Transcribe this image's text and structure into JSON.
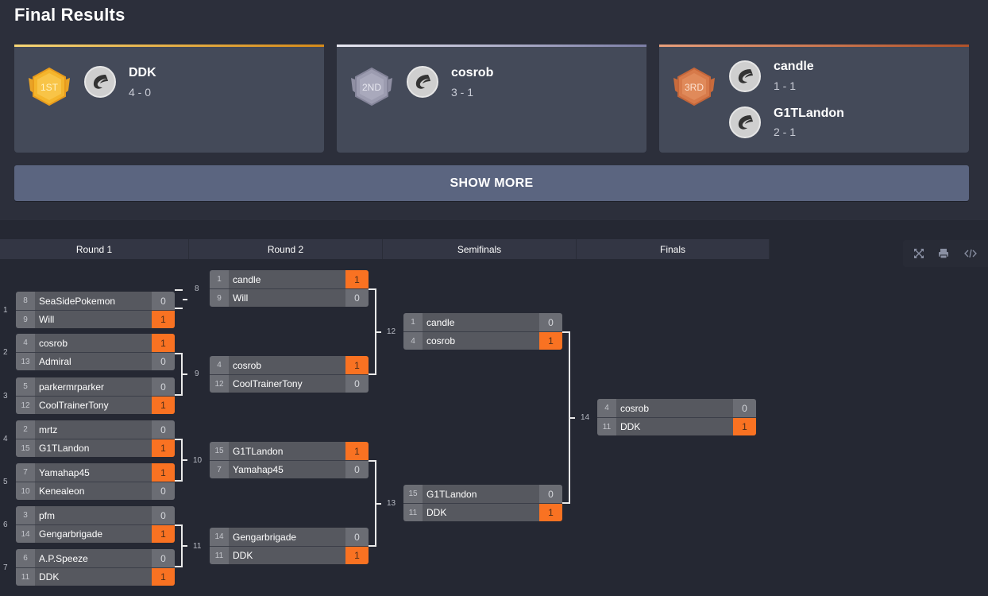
{
  "page_title": "Final Results",
  "colors": {
    "accent_win": "#f97222",
    "gold": "#f2b531",
    "silver": "#9c9cb0",
    "bronze": "#d77a4a"
  },
  "results": [
    {
      "place_label": "1ST",
      "medal_icon": "gold-medal-icon",
      "players": [
        {
          "name": "DDK",
          "record": "4 - 0"
        }
      ]
    },
    {
      "place_label": "2ND",
      "medal_icon": "silver-medal-icon",
      "players": [
        {
          "name": "cosrob",
          "record": "3 - 1"
        }
      ]
    },
    {
      "place_label": "3RD",
      "medal_icon": "bronze-medal-icon",
      "players": [
        {
          "name": "candle",
          "record": "1 - 1"
        },
        {
          "name": "G1TLandon",
          "record": "2 - 1"
        }
      ]
    }
  ],
  "show_more_label": "SHOW MORE",
  "rounds": [
    "Round 1",
    "Round 2",
    "Semifinals",
    "Finals"
  ],
  "toolbar": {
    "icons": [
      "fullscreen-icon",
      "print-icon",
      "embed-code-icon"
    ]
  },
  "matches": [
    {
      "id": "1",
      "teams": [
        {
          "seed": "8",
          "name": "SeaSidePokemon",
          "score": "0",
          "win": false
        },
        {
          "seed": "9",
          "name": "Will",
          "score": "1",
          "win": true
        }
      ]
    },
    {
      "id": "2",
      "teams": [
        {
          "seed": "4",
          "name": "cosrob",
          "score": "1",
          "win": true
        },
        {
          "seed": "13",
          "name": "Admiral",
          "score": "0",
          "win": false
        }
      ]
    },
    {
      "id": "3",
      "teams": [
        {
          "seed": "5",
          "name": "parkermrparker",
          "score": "0",
          "win": false
        },
        {
          "seed": "12",
          "name": "CoolTrainerTony",
          "score": "1",
          "win": true
        }
      ]
    },
    {
      "id": "4",
      "teams": [
        {
          "seed": "2",
          "name": "mrtz",
          "score": "0",
          "win": false
        },
        {
          "seed": "15",
          "name": "G1TLandon",
          "score": "1",
          "win": true
        }
      ]
    },
    {
      "id": "5",
      "teams": [
        {
          "seed": "7",
          "name": "Yamahap45",
          "score": "1",
          "win": true
        },
        {
          "seed": "10",
          "name": "Kenealeon",
          "score": "0",
          "win": false
        }
      ]
    },
    {
      "id": "6",
      "teams": [
        {
          "seed": "3",
          "name": "pfm",
          "score": "0",
          "win": false
        },
        {
          "seed": "14",
          "name": "Gengarbrigade",
          "score": "1",
          "win": true
        }
      ]
    },
    {
      "id": "7",
      "teams": [
        {
          "seed": "6",
          "name": "A.P.Speeze",
          "score": "0",
          "win": false
        },
        {
          "seed": "11",
          "name": "DDK",
          "score": "1",
          "win": true
        }
      ]
    },
    {
      "id": "8",
      "teams": [
        {
          "seed": "1",
          "name": "candle",
          "score": "1",
          "win": true
        },
        {
          "seed": "9",
          "name": "Will",
          "score": "0",
          "win": false
        }
      ]
    },
    {
      "id": "9",
      "teams": [
        {
          "seed": "4",
          "name": "cosrob",
          "score": "1",
          "win": true
        },
        {
          "seed": "12",
          "name": "CoolTrainerTony",
          "score": "0",
          "win": false
        }
      ]
    },
    {
      "id": "10",
      "teams": [
        {
          "seed": "15",
          "name": "G1TLandon",
          "score": "1",
          "win": true
        },
        {
          "seed": "7",
          "name": "Yamahap45",
          "score": "0",
          "win": false
        }
      ]
    },
    {
      "id": "11",
      "teams": [
        {
          "seed": "14",
          "name": "Gengarbrigade",
          "score": "0",
          "win": false
        },
        {
          "seed": "11",
          "name": "DDK",
          "score": "1",
          "win": true
        }
      ]
    },
    {
      "id": "12",
      "teams": [
        {
          "seed": "1",
          "name": "candle",
          "score": "0",
          "win": false
        },
        {
          "seed": "4",
          "name": "cosrob",
          "score": "1",
          "win": true
        }
      ]
    },
    {
      "id": "13",
      "teams": [
        {
          "seed": "15",
          "name": "G1TLandon",
          "score": "0",
          "win": false
        },
        {
          "seed": "11",
          "name": "DDK",
          "score": "1",
          "win": true
        }
      ]
    },
    {
      "id": "14",
      "teams": [
        {
          "seed": "4",
          "name": "cosrob",
          "score": "0",
          "win": false
        },
        {
          "seed": "11",
          "name": "DDK",
          "score": "1",
          "win": true
        }
      ]
    }
  ]
}
